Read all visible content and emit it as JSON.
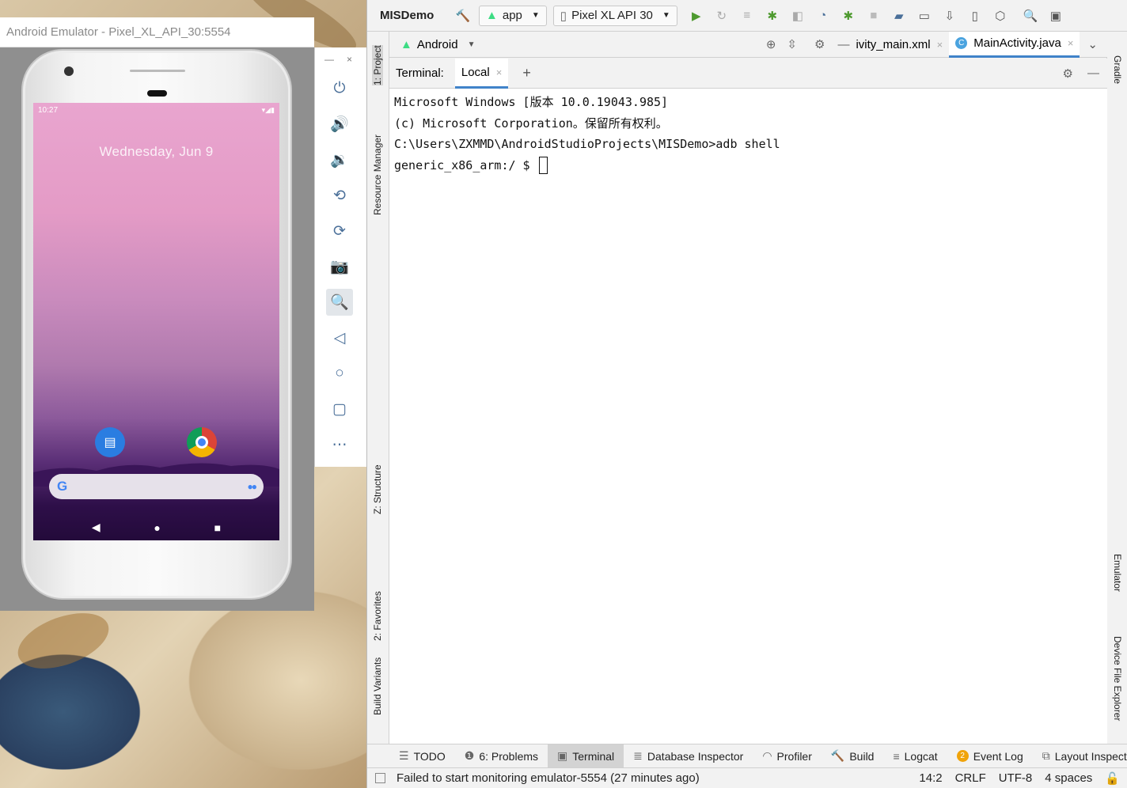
{
  "emulator": {
    "window_title": "Android Emulator - Pixel_XL_API_30:5554",
    "status_time": "10:27",
    "status_icons": "▾◢▮",
    "date": "Wednesday, Jun 9",
    "search_logo": "G",
    "window_controls": {
      "minimize": "—",
      "close": "×"
    },
    "nav": {
      "back": "◀",
      "home": "●",
      "recents": "■"
    },
    "toolbar_icons": [
      "power-icon",
      "volume-up-icon",
      "volume-down-icon",
      "rotate-left-icon",
      "rotate-right-icon",
      "camera-icon",
      "zoom-icon",
      "back-icon",
      "home-icon",
      "overview-icon",
      "more-icon"
    ],
    "toolbar_glyphs": [
      "⏻",
      "🔊",
      "🔉",
      "⟲",
      "⟳",
      "📷",
      "🔍",
      "◁",
      "○",
      "▢",
      "⋯"
    ]
  },
  "studio": {
    "project": "MISDemo",
    "run_config": "app",
    "device": "Pixel XL API 30",
    "project_view": "Android",
    "editor_tabs": [
      {
        "label": "ivity_main.xml"
      },
      {
        "label": "MainActivity.java",
        "icon": "C"
      }
    ],
    "left_tabs": [
      "1: Project",
      "Resource Manager",
      "Z: Structure",
      "2: Favorites",
      "Build Variants"
    ],
    "right_tabs": [
      "Gradle",
      "Emulator",
      "Device File Explorer"
    ],
    "terminal": {
      "label": "Terminal:",
      "tab": "Local",
      "add": "+",
      "lines": [
        "Microsoft Windows [版本 10.0.19043.985]",
        "(c) Microsoft Corporation。保留所有权利。",
        "C:\\Users\\ZXMMD\\AndroidStudioProjects\\MISDemo>adb shell",
        "generic_x86_arm:/ $ "
      ]
    },
    "bottom_tabs": [
      {
        "label": "TODO",
        "icon": "☰"
      },
      {
        "label": "6: Problems",
        "icon": "❶"
      },
      {
        "label": "Terminal",
        "icon": "▣",
        "active": true
      },
      {
        "label": "Database Inspector",
        "icon": "≣"
      },
      {
        "label": "Profiler",
        "icon": "◠"
      },
      {
        "label": "Build",
        "icon": "🔨"
      },
      {
        "label": "Logcat",
        "icon": "≡"
      },
      {
        "label": "Event Log",
        "badge": "2"
      },
      {
        "label": "Layout Inspector",
        "icon": "⧉"
      }
    ],
    "status": {
      "message": "Failed to start monitoring emulator-5554 (27 minutes ago)",
      "position": "14:2",
      "line_sep": "CRLF",
      "encoding": "UTF-8",
      "indent": "4 spaces"
    }
  },
  "colors": {
    "accent": "#4083c9",
    "run_green": "#4e9a2f",
    "android_green": "#3ddc84"
  }
}
